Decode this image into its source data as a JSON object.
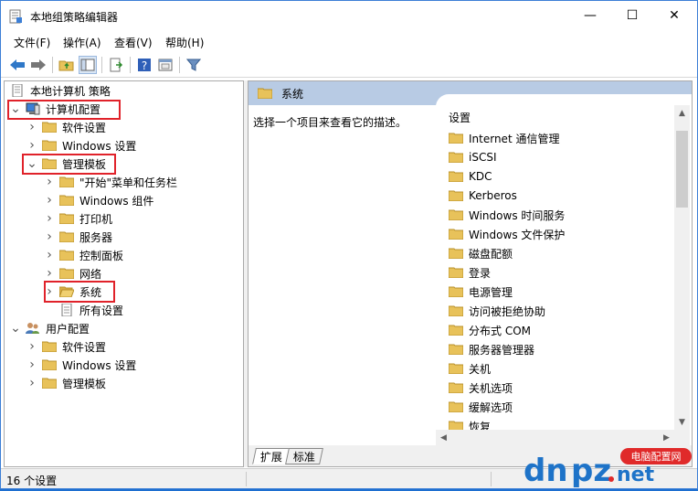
{
  "window": {
    "title": "本地组策略编辑器",
    "minimize_glyph": "—",
    "maximize_glyph": "☐",
    "close_glyph": "✕"
  },
  "menu": [
    "文件(F)",
    "操作(A)",
    "查看(V)",
    "帮助(H)"
  ],
  "tree": {
    "root": "本地计算机 策略",
    "items": [
      {
        "label": "计算机配置",
        "expanded": true,
        "level": 0,
        "icon": "computer-icon",
        "highlight": true
      },
      {
        "label": "软件设置",
        "level": 1,
        "icon": "folder-icon"
      },
      {
        "label": "Windows 设置",
        "level": 1,
        "icon": "folder-icon"
      },
      {
        "label": "管理模板",
        "expanded": true,
        "level": 1,
        "icon": "folder-icon",
        "highlight": true
      },
      {
        "label": "\"开始\"菜单和任务栏",
        "level": 2,
        "icon": "folder-icon"
      },
      {
        "label": "Windows 组件",
        "level": 2,
        "icon": "folder-icon"
      },
      {
        "label": "打印机",
        "level": 2,
        "icon": "folder-icon"
      },
      {
        "label": "服务器",
        "level": 2,
        "icon": "folder-icon"
      },
      {
        "label": "控制面板",
        "level": 2,
        "icon": "folder-icon"
      },
      {
        "label": "网络",
        "level": 2,
        "icon": "folder-icon"
      },
      {
        "label": "系统",
        "level": 2,
        "icon": "folder-open-icon",
        "highlight": true,
        "selected": true
      },
      {
        "label": "所有设置",
        "level": 2,
        "icon": "settings-page-icon"
      },
      {
        "label": "用户配置",
        "expanded": true,
        "level": 0,
        "icon": "users-icon"
      },
      {
        "label": "软件设置",
        "level": 1,
        "icon": "folder-icon"
      },
      {
        "label": "Windows 设置",
        "level": 1,
        "icon": "folder-icon"
      },
      {
        "label": "管理模板",
        "level": 1,
        "icon": "folder-icon"
      }
    ]
  },
  "right": {
    "header": "系统",
    "description": "选择一个项目来查看它的描述。",
    "column_header": "设置",
    "items": [
      "Internet 通信管理",
      "iSCSI",
      "KDC",
      "Kerberos",
      "Windows 时间服务",
      "Windows 文件保护",
      "磁盘配额",
      "登录",
      "电源管理",
      "访问被拒绝协助",
      "分布式 COM",
      "服务器管理器",
      "关机",
      "关机选项",
      "缓解选项",
      "恢复"
    ],
    "tabs": [
      "扩展",
      "标准"
    ]
  },
  "status": {
    "text": "16 个设置"
  },
  "watermark": {
    "logo_text": "dnpz.net",
    "site_name": "电脑配置网"
  },
  "colors": {
    "accent": "#3c7fd6",
    "header_bg": "#b8cbe4",
    "highlight_red": "#e0222a",
    "folder": "#e8c25a"
  }
}
